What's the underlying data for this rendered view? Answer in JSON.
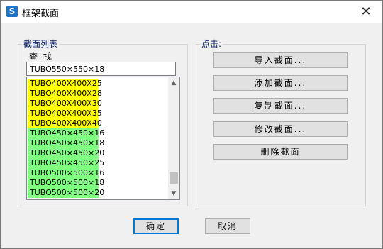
{
  "window": {
    "title": "框架截面",
    "icon_letter": "S",
    "close_glyph": "✕"
  },
  "section_list": {
    "group_label": "截面列表",
    "find_label": "查 找",
    "search_value": "TUBO550×550×18",
    "items": [
      {
        "label": "TUBO400X400X25",
        "color": "#ffff00"
      },
      {
        "label": "TUBO400X400X28",
        "color": "#ffff00"
      },
      {
        "label": "TUBO400X400X30",
        "color": "#ffff00"
      },
      {
        "label": "TUBO400X400X35",
        "color": "#ffff00"
      },
      {
        "label": "TUBO400X400X40",
        "color": "#ffff00"
      },
      {
        "label": "TUBO450×450×16",
        "color": "#80ff80"
      },
      {
        "label": "TUBO450×450×18",
        "color": "#80ff80"
      },
      {
        "label": "TUBO450×450×20",
        "color": "#80ff80"
      },
      {
        "label": "TUBO450×450×25",
        "color": "#80ff80"
      },
      {
        "label": "TUBO500×500×16",
        "color": "#80ff80"
      },
      {
        "label": "TUBO500×500×18",
        "color": "#80ff80"
      },
      {
        "label": "TUBO500×500×20",
        "color": "#80ff80"
      }
    ]
  },
  "actions": {
    "group_label": "点击:",
    "import_label": "导入截面...",
    "add_label": "添加截面...",
    "copy_label": "复制截面...",
    "modify_label": "修改截面...",
    "delete_label": "删除截面"
  },
  "footer": {
    "ok_label": "确定",
    "cancel_label": "取消"
  }
}
